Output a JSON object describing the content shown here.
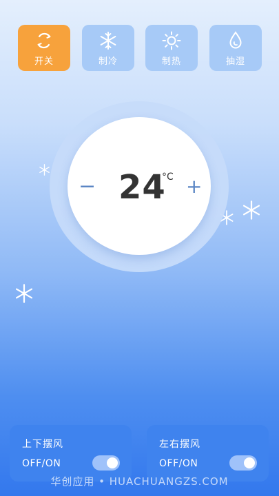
{
  "modes": [
    {
      "label": "开关",
      "icon": "power-cycle-icon",
      "active": true
    },
    {
      "label": "制冷",
      "icon": "snowflake-icon",
      "active": false
    },
    {
      "label": "制热",
      "icon": "sun-icon",
      "active": false
    },
    {
      "label": "抽湿",
      "icon": "droplet-icon",
      "active": false
    }
  ],
  "thermostat": {
    "temperature": "24",
    "unit": "°C",
    "decrease_label": "−",
    "increase_label": "+"
  },
  "swing": {
    "vertical": {
      "title": "上下摆风",
      "state_label": "OFF/ON",
      "on": true
    },
    "horizontal": {
      "title": "左右摆风",
      "state_label": "OFF/ON",
      "on": true
    }
  },
  "watermark": "华创应用 • HUACHUANGZS.COM",
  "colors": {
    "active_mode": "#f7a23c",
    "inactive_mode": "#a7caf7",
    "card": "#3f83ee",
    "accent_text": "#5b86c4"
  }
}
